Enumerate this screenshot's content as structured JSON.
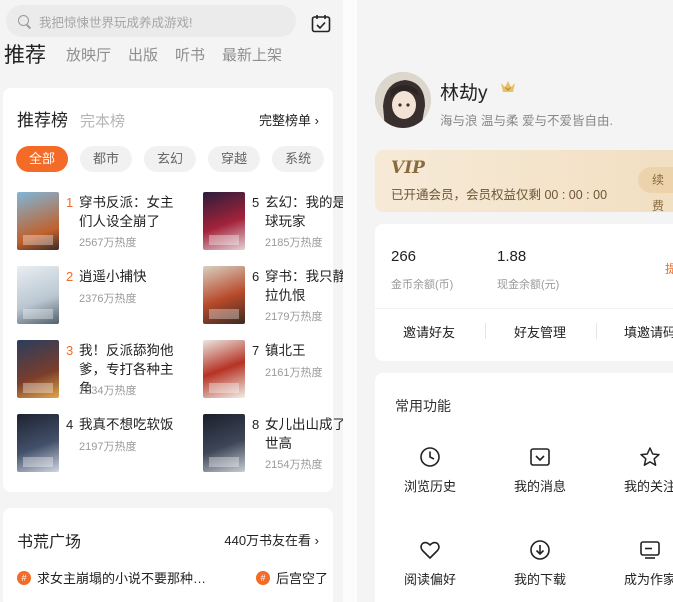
{
  "left": {
    "search": {
      "placeholder": "我把惊悚世界玩成养成游戏!",
      "icon": "search-icon"
    },
    "calendar_icon": "calendar-check-icon",
    "tabs": [
      {
        "label": "推荐"
      },
      {
        "label": "放映厅"
      },
      {
        "label": "出版"
      },
      {
        "label": "听书"
      },
      {
        "label": "最新上架"
      }
    ],
    "ranking": {
      "title": "推荐榜",
      "subtitle": "完本榜",
      "more": "完整榜单 ›",
      "chips": [
        "全部",
        "都市",
        "玄幻",
        "穿越",
        "系统"
      ],
      "books": [
        {
          "rank": "1",
          "title": "穿书反派：女主们人设全崩了",
          "heat": "2567万热度",
          "rank_color": "#f36b26"
        },
        {
          "rank": "2",
          "title": "逍遥小捕快",
          "heat": "2376万热度",
          "rank_color": "#f36b26"
        },
        {
          "rank": "3",
          "title": "我！反派舔狗他爹，专打各种主角",
          "heat": "2234万热度",
          "rank_color": "#f36b26"
        },
        {
          "rank": "4",
          "title": "我真不想吃软饭",
          "heat": "2197万热度",
          "rank_color": "#222222"
        },
        {
          "rank": "5",
          "title": "玄幻：我的是地球玩家",
          "heat": "2185万热度",
          "rank_color": "#222222"
        },
        {
          "rank": "6",
          "title": "穿书：我只静静拉仇恨",
          "heat": "2179万热度",
          "rank_color": "#222222"
        },
        {
          "rank": "7",
          "title": "镇北王",
          "heat": "2161万热度",
          "rank_color": "#222222"
        },
        {
          "rank": "8",
          "title": "女儿出山成了隐世高",
          "heat": "2154万热度",
          "rank_color": "#222222"
        }
      ]
    },
    "plaza": {
      "title": "书荒广场",
      "more": "440万书友在看 ›",
      "topics": [
        {
          "text": "求女主崩塌的小说不要那种…"
        },
        {
          "text": "后宫空了"
        }
      ]
    }
  },
  "right": {
    "user": {
      "name": "林劫y",
      "motto": "海与浪 温与柔 爱与不爱皆自由.",
      "badge_icon": "crown-icon"
    },
    "vip": {
      "title": "VIP",
      "text": "已开通会员，会员权益仅剩 00 : 00 : 00",
      "button": "续费"
    },
    "wallet": {
      "coins": "266",
      "coins_label": "金币余额(币)",
      "cash": "1.88",
      "cash_label": "现金余额(元)",
      "withdraw": "提",
      "links": [
        "邀请好友",
        "好友管理",
        "填邀请码"
      ]
    },
    "functions": {
      "title": "常用功能",
      "items": [
        {
          "label": "浏览历史",
          "icon": "clock-icon"
        },
        {
          "label": "我的消息",
          "icon": "message-icon"
        },
        {
          "label": "我的关注",
          "icon": "star-icon"
        },
        {
          "label": "阅读偏好",
          "icon": "heart-icon"
        },
        {
          "label": "我的下载",
          "icon": "download-icon"
        },
        {
          "label": "成为作家",
          "icon": "write-icon"
        }
      ]
    }
  },
  "colors": {
    "accent": "#f36b26",
    "vip_gold": "#8a6a3d"
  }
}
